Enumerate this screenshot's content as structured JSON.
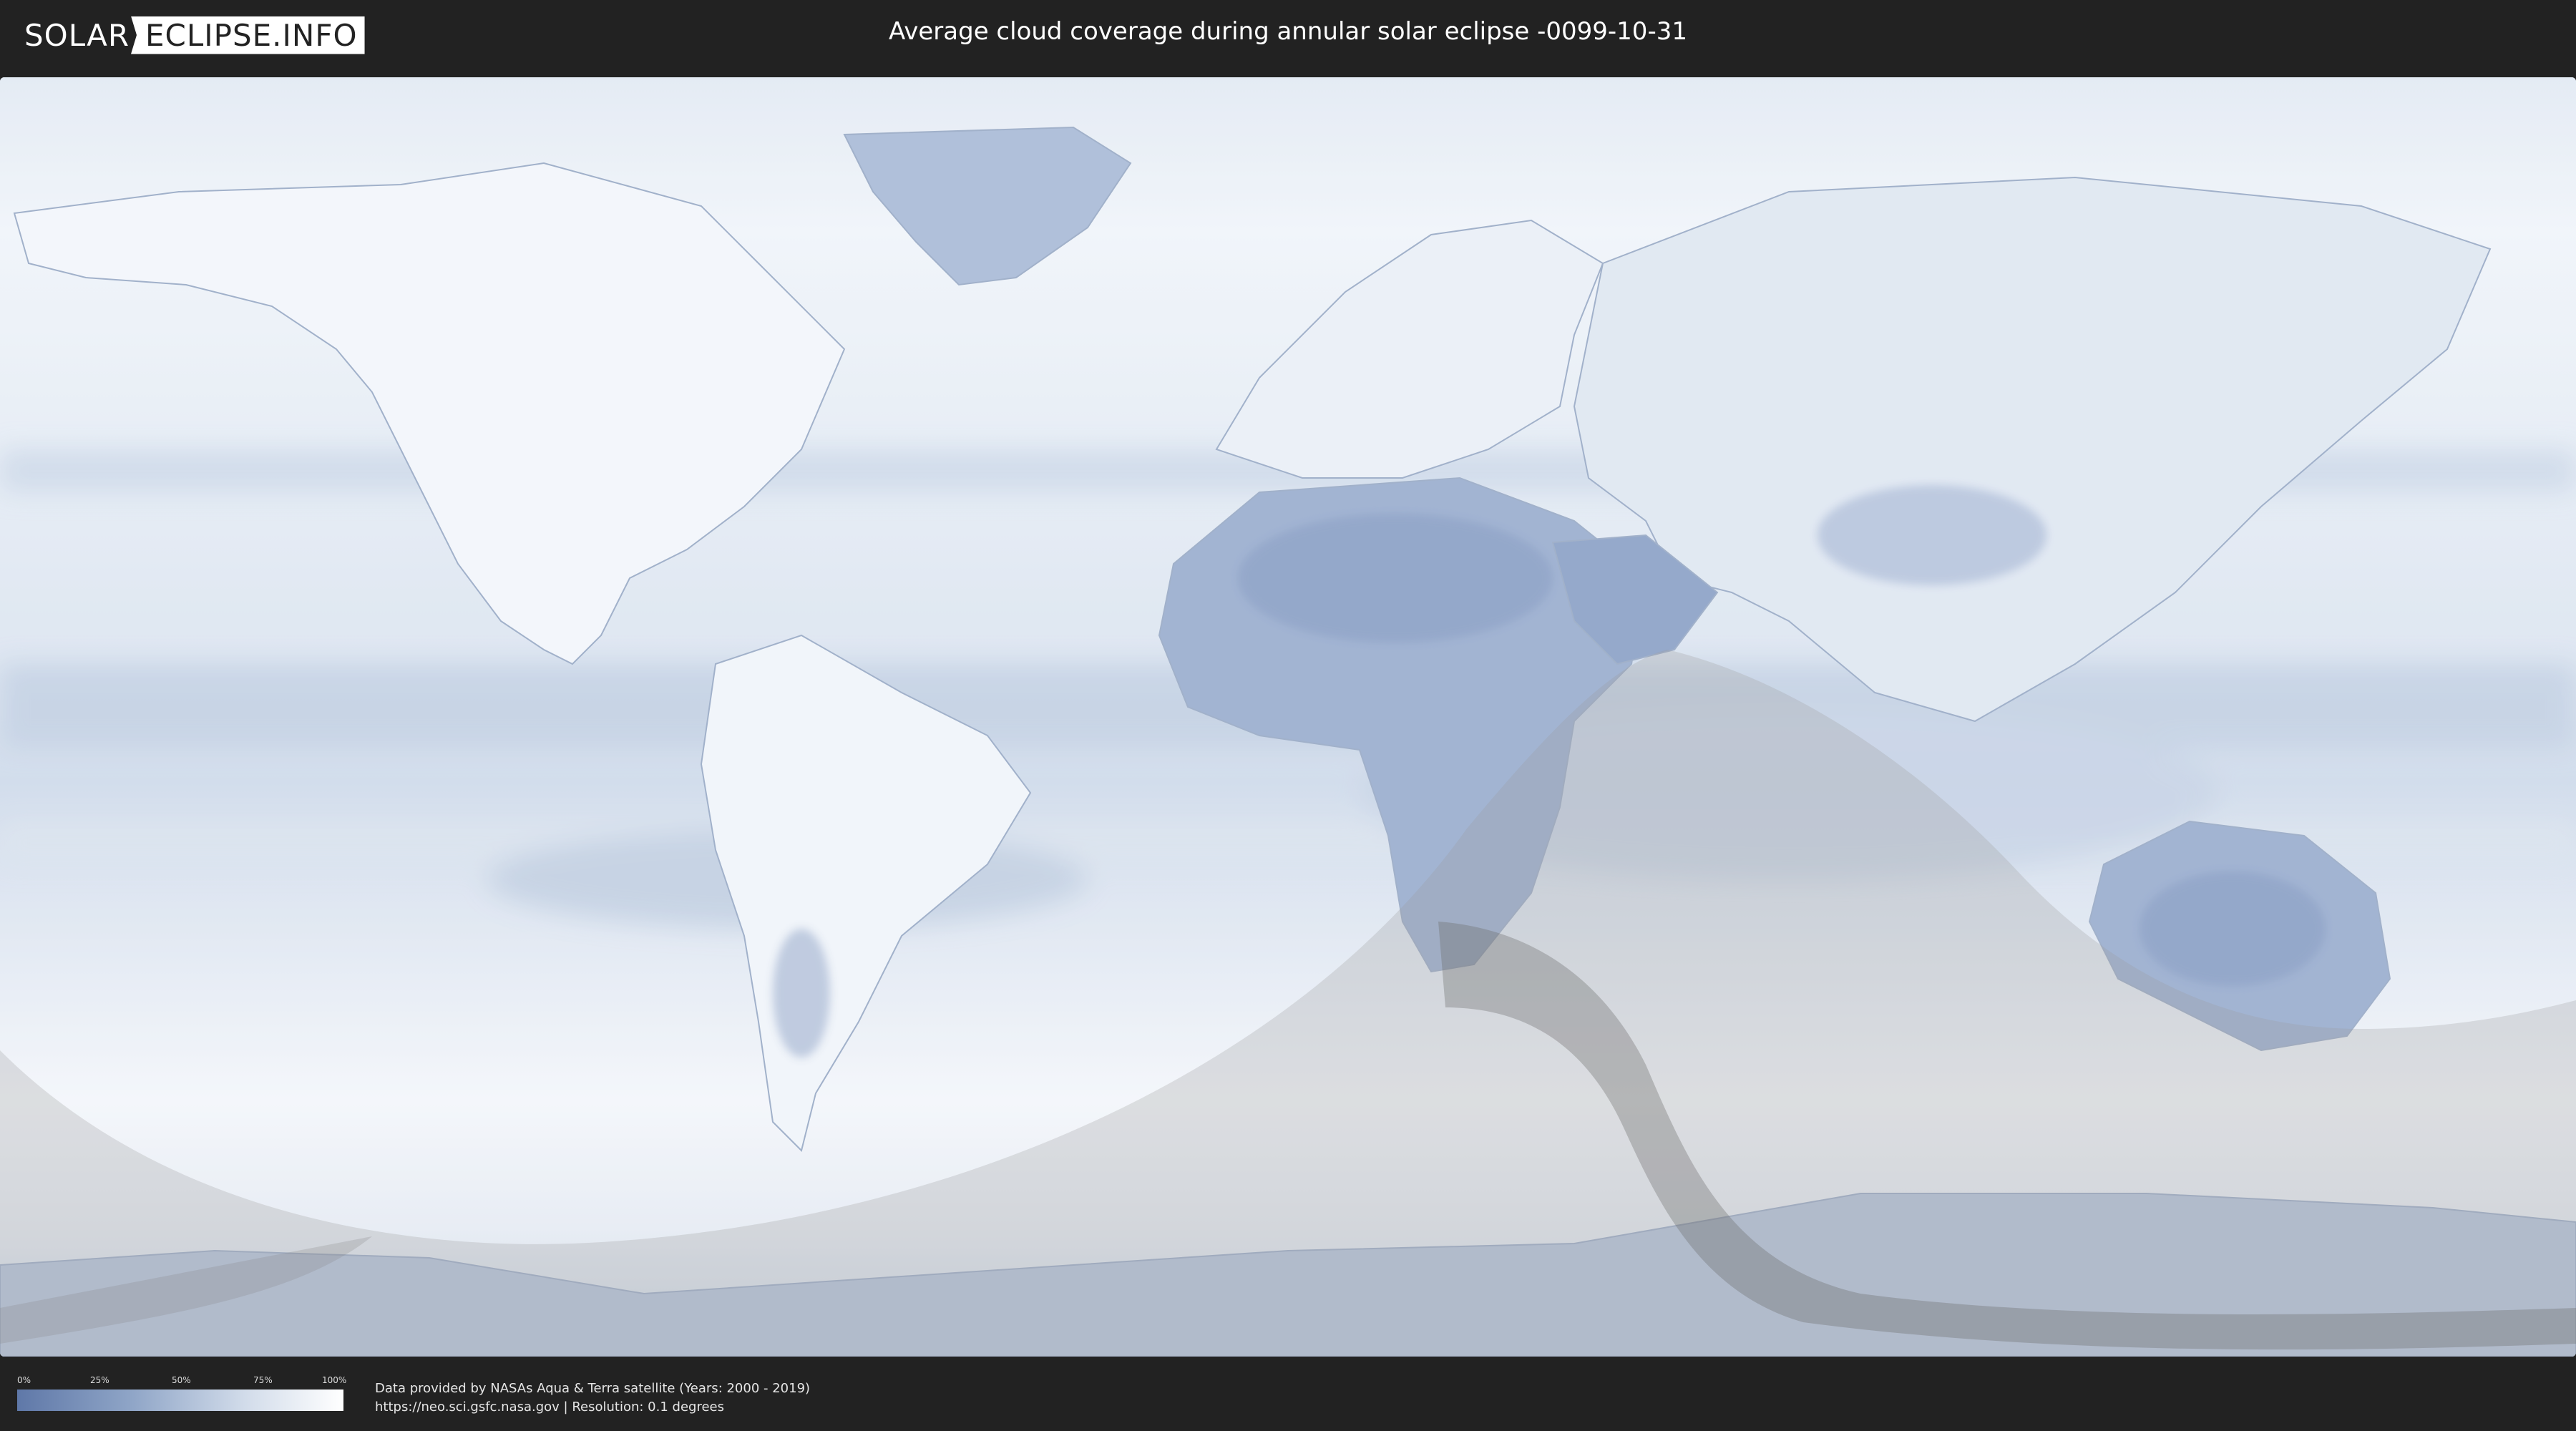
{
  "header": {
    "logo_left": "SOLAR",
    "logo_right": "ECLIPSE.INFO",
    "title": "Average cloud coverage during annular solar eclipse -0099-10-31"
  },
  "legend": {
    "ticks": [
      "0%",
      "25%",
      "50%",
      "75%",
      "100%"
    ],
    "colors": {
      "low": "#5f78a8",
      "high": "#ffffff"
    }
  },
  "footer": {
    "credit_line1": "Data provided by NASAs Aqua & Terra satellite (Years: 2000 - 2019)",
    "credit_line2": "https://neo.sci.gsfc.nasa.gov | Resolution: 0.1 degrees"
  },
  "map": {
    "projection": "equirectangular",
    "layers": [
      "cloud-coverage",
      "country-borders",
      "eclipse-visibility-zone",
      "annular-path"
    ],
    "colors": {
      "ocean_cloud": "#e9eff7",
      "land_clear": "#7a93bf",
      "eclipse_shade": "#9a9a9a",
      "annular_path": "#5a5a5a"
    }
  }
}
